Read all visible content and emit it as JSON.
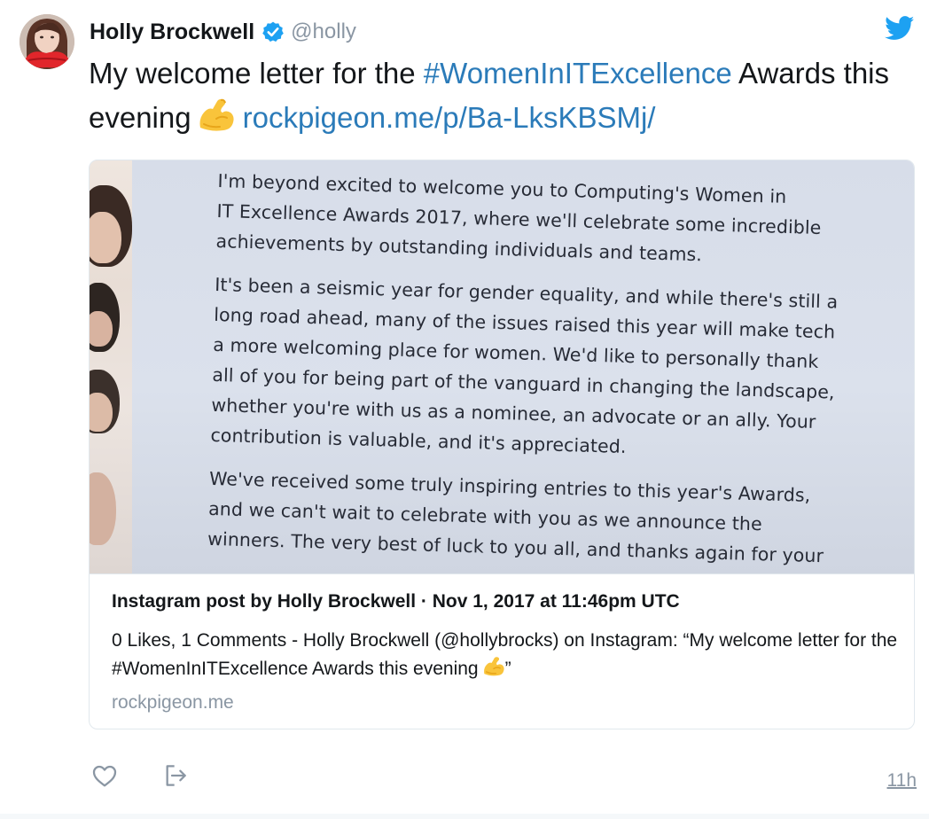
{
  "author": {
    "display_name": "Holly Brockwell",
    "handle": "@holly",
    "verified": true
  },
  "tweet": {
    "text_part1": "My welcome letter for the ",
    "hashtag": "#WomenInITExcellence",
    "text_part2": " Awards this evening",
    "emoji": "flexed-biceps-emoji",
    "link": "rockpigeon.me/p/Ba-LksKBSMj/"
  },
  "card": {
    "image_letter": {
      "paragraph1": "I'm beyond excited to welcome you to Computing's Women in\nIT Excellence Awards 2017, where we'll celebrate some incredible\nachievements by outstanding individuals and teams.",
      "paragraph2": "It's been a seismic year for gender equality, and while there's still a\nlong road ahead, many of the issues raised this year will make tech\na more welcoming place for women. We'd like to personally thank\nall of you for being part of the vanguard in changing the landscape,\nwhether you're with us as a nominee, an advocate or an ally. Your\ncontribution is valuable, and it's appreciated.",
      "paragraph3": "We've received some truly inspiring entries to this year's Awards,\nand we can't wait to celebrate with you as we announce the\nwinners. The very best of luck to you all, and thanks again for your"
    },
    "title": "Instagram post by Holly Brockwell · Nov 1, 2017 at 11:46pm UTC",
    "description": "0 Likes, 1 Comments - Holly Brockwell (@hollybrocks) on Instagram: “My welcome letter for the #WomenInITExcellence Awards this evening",
    "description_end": "”",
    "domain": "rockpigeon.me"
  },
  "actions": {
    "like_icon": "heart-icon",
    "share_icon": "share-icon",
    "timestamp": "11h"
  },
  "colors": {
    "link": "#2b7bb9",
    "verified": "#1da1f2",
    "muted": "#8a96a3",
    "twitter_brand": "#1da1f2"
  }
}
